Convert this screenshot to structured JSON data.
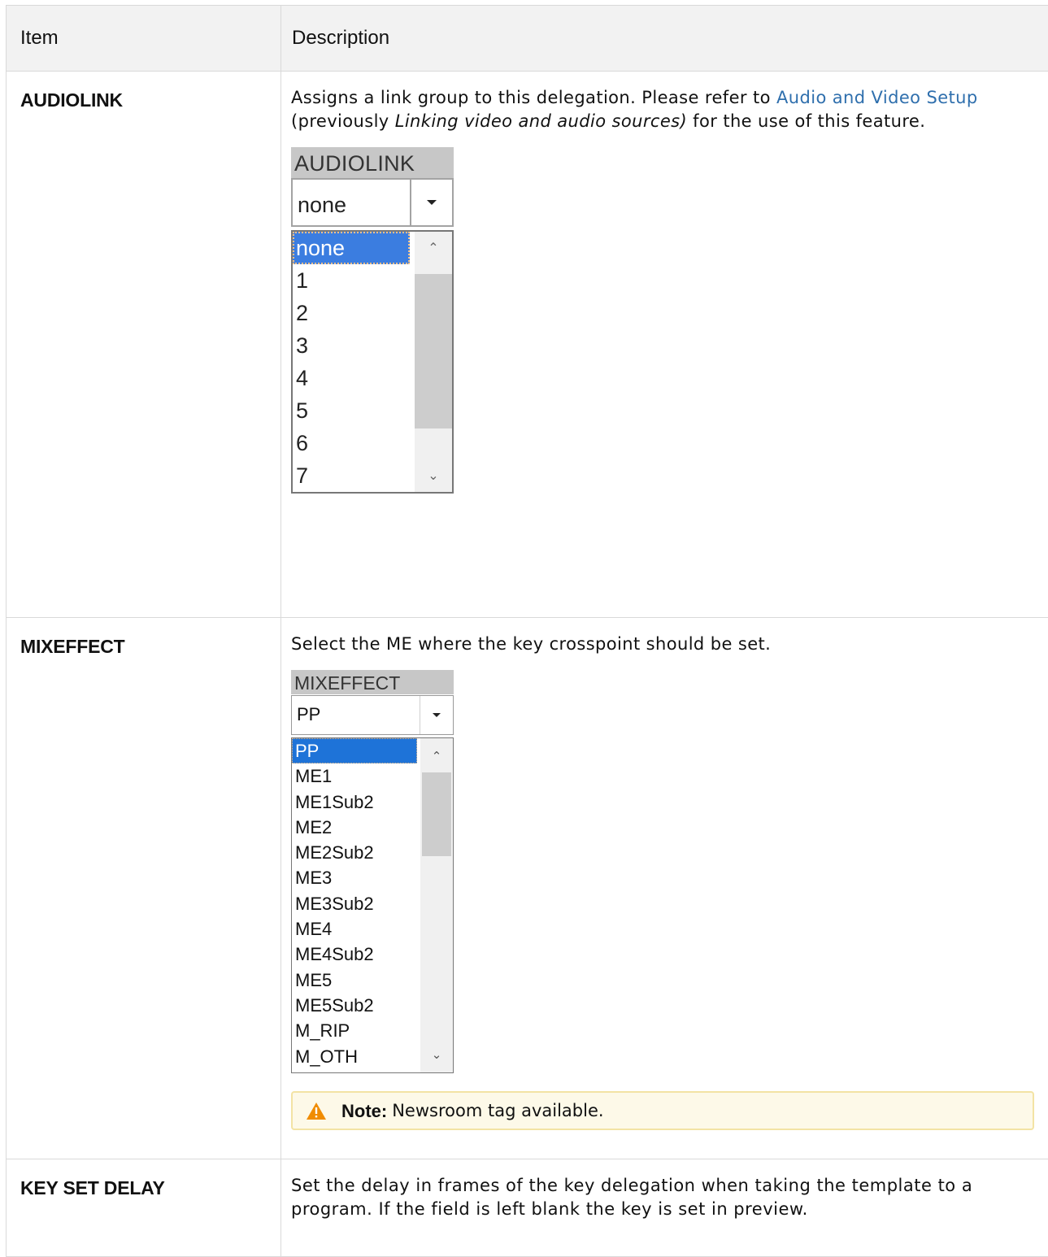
{
  "header": {
    "item": "Item",
    "description": "Description"
  },
  "rows": [
    {
      "item": "AUDIOLINK",
      "text_before": "Assigns a link group to this delegation. Please refer to ",
      "link": "Audio and Video Setup",
      "text_mid": " (previously ",
      "emphasis": "Linking video and audio sources)",
      "text_after": " for the use of this feature."
    },
    {
      "item": "MIXEFFECT",
      "text": "Select the ME where the key crosspoint should be set.",
      "note_label": "Note:",
      "note_text": "Newsroom tag available."
    },
    {
      "item": "KEY SET DELAY",
      "text": "Set the delay in frames of the key delegation when taking the template to a program. If the field is left blank the key is set in preview."
    }
  ],
  "audiolink_widget": {
    "title": "AUDIOLINK",
    "selected": "none",
    "options": [
      "none",
      "1",
      "2",
      "3",
      "4",
      "5",
      "6",
      "7"
    ]
  },
  "mixeffect_widget": {
    "title": "MIXEFFECT",
    "selected": "PP",
    "options": [
      "PP",
      "ME1",
      "ME1Sub2",
      "ME2",
      "ME2Sub2",
      "ME3",
      "ME3Sub2",
      "ME4",
      "ME4Sub2",
      "ME5",
      "ME5Sub2",
      "M_RIP",
      "M_OTH"
    ]
  },
  "icons": {
    "dropdown": "chevron-down-icon",
    "scroll_up": "scroll-up-icon",
    "scroll_down": "scroll-down-icon",
    "warning": "warning-icon"
  },
  "colors": {
    "link": "#2f6fad",
    "selection": "#1e73d8",
    "note_bg": "#fdf9e8",
    "warning": "#f08c00"
  }
}
